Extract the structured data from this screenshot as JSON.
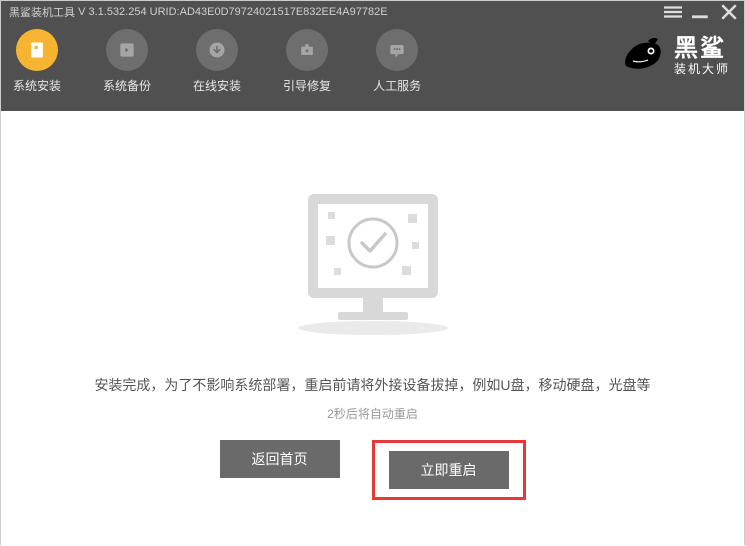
{
  "titlebar": {
    "app_name": "黑鲨装机工具",
    "version_prefix": "V",
    "version": "3.1.532.254",
    "urid_label": "URID:",
    "urid": "AD43E0D79724021517E832EE4A97782E"
  },
  "nav": {
    "items": [
      {
        "label": "系统安装",
        "icon": "install"
      },
      {
        "label": "系统备份",
        "icon": "backup"
      },
      {
        "label": "在线安装",
        "icon": "download"
      },
      {
        "label": "引导修复",
        "icon": "repair"
      },
      {
        "label": "人工服务",
        "icon": "chat"
      }
    ]
  },
  "logo": {
    "big": "黑鲨",
    "small": "装机大师"
  },
  "content": {
    "message": "安装完成，为了不影响系统部署，重启前请将外接设备拔掉，例如U盘，移动硬盘，光盘等",
    "countdown": "2秒后将自动重启",
    "back_label": "返回首页",
    "restart_label": "立即重启"
  }
}
